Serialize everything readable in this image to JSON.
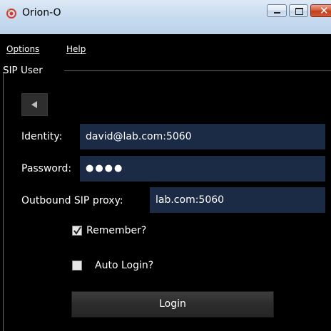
{
  "window": {
    "title": "Orion-O"
  },
  "menu": {
    "items": [
      {
        "label": "Options"
      },
      {
        "label": "Help"
      }
    ]
  },
  "group": {
    "title": "SIP User"
  },
  "icons": {
    "app": "orion-logo-icon",
    "back": "triangle-left-icon",
    "check": "checkmark-icon"
  },
  "form": {
    "identity": {
      "label": "Identity:",
      "value": "david@lab.com:5060"
    },
    "password": {
      "label": "Password:",
      "value": "●●●●"
    },
    "proxy": {
      "label": "Outbound SIP proxy:",
      "value": "lab.com:5060"
    }
  },
  "options": {
    "remember": {
      "label": "Remember?",
      "checked": true
    },
    "auto_login": {
      "label": "Auto Login?",
      "checked": false
    }
  },
  "actions": {
    "login_label": "Login"
  },
  "colors": {
    "background": "#000000",
    "input_bg": "#1c2b45",
    "close_button": "#c23e1d",
    "titlebar": "#c9dcf0"
  }
}
